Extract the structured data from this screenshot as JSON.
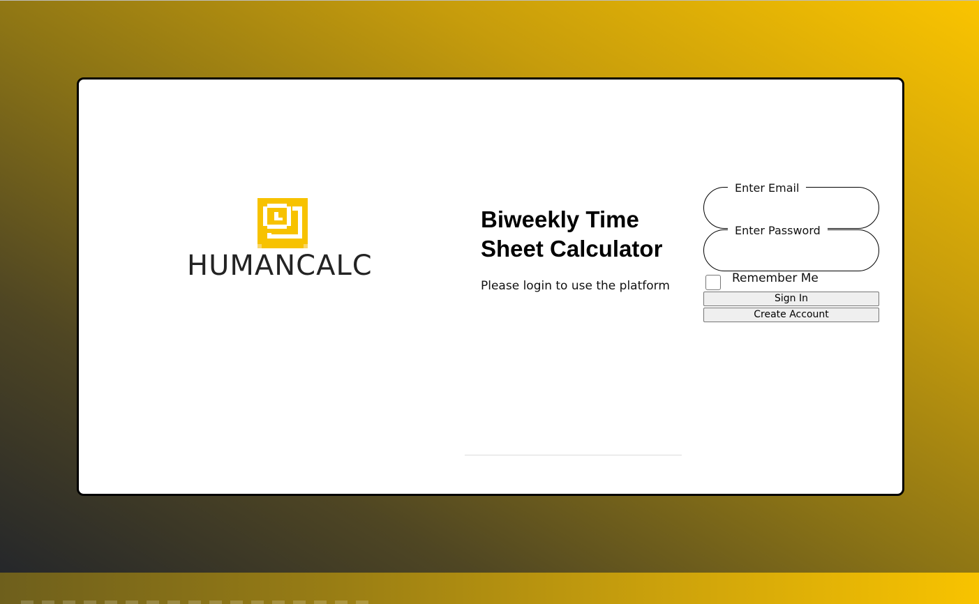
{
  "brand": {
    "name": "HUMANCALC",
    "logo_icon": "clock-square-icon",
    "accent_color": "#f7c200",
    "text_color": "#232323"
  },
  "hero": {
    "title": "Biweekly Time Sheet Calculator",
    "subtitle": "Please login to use the platform"
  },
  "login_form": {
    "email_label": "Enter Email",
    "email_value": "",
    "password_label": "Enter Password",
    "password_value": "",
    "remember_label": "Remember Me",
    "remember_checked": false,
    "sign_in_label": "Sign In",
    "create_account_label": "Create Account"
  },
  "theme": {
    "gradient_start": "#25272a",
    "gradient_end": "#fac400",
    "card_background": "#ffffff",
    "card_border": "#000000"
  }
}
